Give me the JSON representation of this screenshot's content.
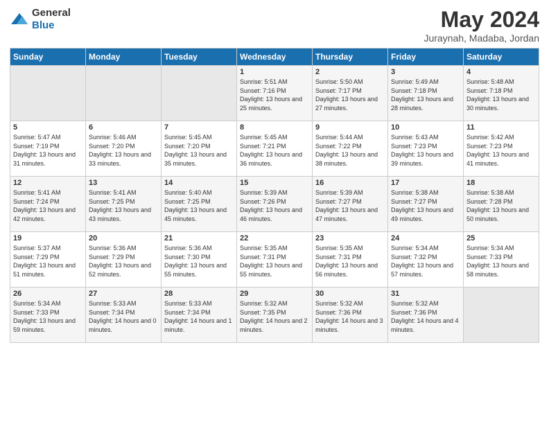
{
  "header": {
    "logo_general": "General",
    "logo_blue": "Blue",
    "month": "May 2024",
    "location": "Juraynah, Madaba, Jordan"
  },
  "weekdays": [
    "Sunday",
    "Monday",
    "Tuesday",
    "Wednesday",
    "Thursday",
    "Friday",
    "Saturday"
  ],
  "weeks": [
    [
      {
        "day": "",
        "sunrise": "",
        "sunset": "",
        "daylight": "",
        "empty": true
      },
      {
        "day": "",
        "sunrise": "",
        "sunset": "",
        "daylight": "",
        "empty": true
      },
      {
        "day": "",
        "sunrise": "",
        "sunset": "",
        "daylight": "",
        "empty": true
      },
      {
        "day": "1",
        "sunrise": "Sunrise: 5:51 AM",
        "sunset": "Sunset: 7:16 PM",
        "daylight": "Daylight: 13 hours and 25 minutes.",
        "empty": false
      },
      {
        "day": "2",
        "sunrise": "Sunrise: 5:50 AM",
        "sunset": "Sunset: 7:17 PM",
        "daylight": "Daylight: 13 hours and 27 minutes.",
        "empty": false
      },
      {
        "day": "3",
        "sunrise": "Sunrise: 5:49 AM",
        "sunset": "Sunset: 7:18 PM",
        "daylight": "Daylight: 13 hours and 28 minutes.",
        "empty": false
      },
      {
        "day": "4",
        "sunrise": "Sunrise: 5:48 AM",
        "sunset": "Sunset: 7:18 PM",
        "daylight": "Daylight: 13 hours and 30 minutes.",
        "empty": false
      }
    ],
    [
      {
        "day": "5",
        "sunrise": "Sunrise: 5:47 AM",
        "sunset": "Sunset: 7:19 PM",
        "daylight": "Daylight: 13 hours and 31 minutes.",
        "empty": false
      },
      {
        "day": "6",
        "sunrise": "Sunrise: 5:46 AM",
        "sunset": "Sunset: 7:20 PM",
        "daylight": "Daylight: 13 hours and 33 minutes.",
        "empty": false
      },
      {
        "day": "7",
        "sunrise": "Sunrise: 5:45 AM",
        "sunset": "Sunset: 7:20 PM",
        "daylight": "Daylight: 13 hours and 35 minutes.",
        "empty": false
      },
      {
        "day": "8",
        "sunrise": "Sunrise: 5:45 AM",
        "sunset": "Sunset: 7:21 PM",
        "daylight": "Daylight: 13 hours and 36 minutes.",
        "empty": false
      },
      {
        "day": "9",
        "sunrise": "Sunrise: 5:44 AM",
        "sunset": "Sunset: 7:22 PM",
        "daylight": "Daylight: 13 hours and 38 minutes.",
        "empty": false
      },
      {
        "day": "10",
        "sunrise": "Sunrise: 5:43 AM",
        "sunset": "Sunset: 7:23 PM",
        "daylight": "Daylight: 13 hours and 39 minutes.",
        "empty": false
      },
      {
        "day": "11",
        "sunrise": "Sunrise: 5:42 AM",
        "sunset": "Sunset: 7:23 PM",
        "daylight": "Daylight: 13 hours and 41 minutes.",
        "empty": false
      }
    ],
    [
      {
        "day": "12",
        "sunrise": "Sunrise: 5:41 AM",
        "sunset": "Sunset: 7:24 PM",
        "daylight": "Daylight: 13 hours and 42 minutes.",
        "empty": false
      },
      {
        "day": "13",
        "sunrise": "Sunrise: 5:41 AM",
        "sunset": "Sunset: 7:25 PM",
        "daylight": "Daylight: 13 hours and 43 minutes.",
        "empty": false
      },
      {
        "day": "14",
        "sunrise": "Sunrise: 5:40 AM",
        "sunset": "Sunset: 7:25 PM",
        "daylight": "Daylight: 13 hours and 45 minutes.",
        "empty": false
      },
      {
        "day": "15",
        "sunrise": "Sunrise: 5:39 AM",
        "sunset": "Sunset: 7:26 PM",
        "daylight": "Daylight: 13 hours and 46 minutes.",
        "empty": false
      },
      {
        "day": "16",
        "sunrise": "Sunrise: 5:39 AM",
        "sunset": "Sunset: 7:27 PM",
        "daylight": "Daylight: 13 hours and 47 minutes.",
        "empty": false
      },
      {
        "day": "17",
        "sunrise": "Sunrise: 5:38 AM",
        "sunset": "Sunset: 7:27 PM",
        "daylight": "Daylight: 13 hours and 49 minutes.",
        "empty": false
      },
      {
        "day": "18",
        "sunrise": "Sunrise: 5:38 AM",
        "sunset": "Sunset: 7:28 PM",
        "daylight": "Daylight: 13 hours and 50 minutes.",
        "empty": false
      }
    ],
    [
      {
        "day": "19",
        "sunrise": "Sunrise: 5:37 AM",
        "sunset": "Sunset: 7:29 PM",
        "daylight": "Daylight: 13 hours and 51 minutes.",
        "empty": false
      },
      {
        "day": "20",
        "sunrise": "Sunrise: 5:36 AM",
        "sunset": "Sunset: 7:29 PM",
        "daylight": "Daylight: 13 hours and 52 minutes.",
        "empty": false
      },
      {
        "day": "21",
        "sunrise": "Sunrise: 5:36 AM",
        "sunset": "Sunset: 7:30 PM",
        "daylight": "Daylight: 13 hours and 55 minutes.",
        "empty": false
      },
      {
        "day": "22",
        "sunrise": "Sunrise: 5:35 AM",
        "sunset": "Sunset: 7:31 PM",
        "daylight": "Daylight: 13 hours and 55 minutes.",
        "empty": false
      },
      {
        "day": "23",
        "sunrise": "Sunrise: 5:35 AM",
        "sunset": "Sunset: 7:31 PM",
        "daylight": "Daylight: 13 hours and 56 minutes.",
        "empty": false
      },
      {
        "day": "24",
        "sunrise": "Sunrise: 5:34 AM",
        "sunset": "Sunset: 7:32 PM",
        "daylight": "Daylight: 13 hours and 57 minutes.",
        "empty": false
      },
      {
        "day": "25",
        "sunrise": "Sunrise: 5:34 AM",
        "sunset": "Sunset: 7:33 PM",
        "daylight": "Daylight: 13 hours and 58 minutes.",
        "empty": false
      }
    ],
    [
      {
        "day": "26",
        "sunrise": "Sunrise: 5:34 AM",
        "sunset": "Sunset: 7:33 PM",
        "daylight": "Daylight: 13 hours and 59 minutes.",
        "empty": false
      },
      {
        "day": "27",
        "sunrise": "Sunrise: 5:33 AM",
        "sunset": "Sunset: 7:34 PM",
        "daylight": "Daylight: 14 hours and 0 minutes.",
        "empty": false
      },
      {
        "day": "28",
        "sunrise": "Sunrise: 5:33 AM",
        "sunset": "Sunset: 7:34 PM",
        "daylight": "Daylight: 14 hours and 1 minute.",
        "empty": false
      },
      {
        "day": "29",
        "sunrise": "Sunrise: 5:32 AM",
        "sunset": "Sunset: 7:35 PM",
        "daylight": "Daylight: 14 hours and 2 minutes.",
        "empty": false
      },
      {
        "day": "30",
        "sunrise": "Sunrise: 5:32 AM",
        "sunset": "Sunset: 7:36 PM",
        "daylight": "Daylight: 14 hours and 3 minutes.",
        "empty": false
      },
      {
        "day": "31",
        "sunrise": "Sunrise: 5:32 AM",
        "sunset": "Sunset: 7:36 PM",
        "daylight": "Daylight: 14 hours and 4 minutes.",
        "empty": false
      },
      {
        "day": "",
        "sunrise": "",
        "sunset": "",
        "daylight": "",
        "empty": true
      }
    ]
  ]
}
